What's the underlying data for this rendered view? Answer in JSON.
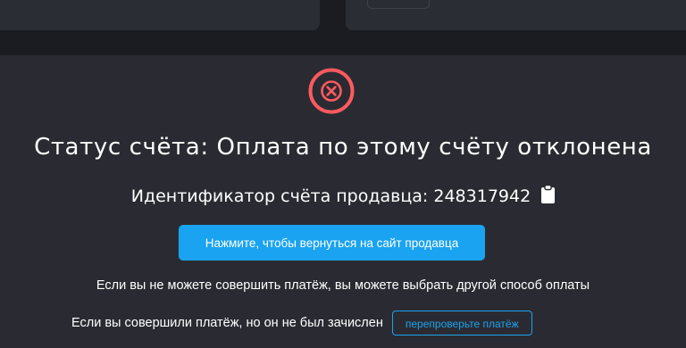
{
  "status": {
    "title": "Статус счёта: Оплата по этому счёту отклонена",
    "icon": "error-x-icon",
    "icon_color": "#ff5a5f"
  },
  "merchant": {
    "id_label": "Идентификатор счёта продавца:",
    "id_value": "248317942",
    "copy_icon": "clipboard-icon"
  },
  "actions": {
    "return_label": "Нажмите, чтобы вернуться на сайт продавца",
    "recheck_label": "перепроверьте платёж"
  },
  "help": {
    "other_method_text": "Если вы не можете совершить платёж, вы можете выбрать другой способ оплаты",
    "not_credited_text": "Если вы совершили платёж, но он не был зачислен"
  },
  "colors": {
    "background": "#1b1c21",
    "panel": "#2a2b32",
    "accent": "#1aa3f0",
    "error": "#ff5a5f"
  }
}
